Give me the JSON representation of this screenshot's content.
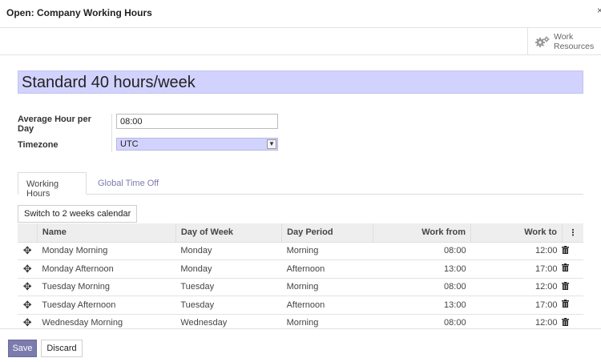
{
  "modal": {
    "title": "Open: Company Working Hours",
    "close": "×"
  },
  "button_box": {
    "work_resources_label": "Work Resources",
    "icon": "gears-icon"
  },
  "record": {
    "name": "Standard 40 hours/week"
  },
  "fields": {
    "avg_hour_label": "Average Hour per Day",
    "avg_hour_value": "08:00",
    "timezone_label": "Timezone",
    "timezone_value": "UTC"
  },
  "tabs": [
    {
      "label": "Working Hours",
      "active": true
    },
    {
      "label": "Global Time Off",
      "active": false
    }
  ],
  "switch_button": "Switch to 2 weeks calendar",
  "table": {
    "headers": {
      "name": "Name",
      "day_of_week": "Day of Week",
      "day_period": "Day Period",
      "work_from": "Work from",
      "work_to": "Work to",
      "options": "⋮"
    },
    "rows": [
      {
        "name": "Monday Morning",
        "day_of_week": "Monday",
        "day_period": "Morning",
        "work_from": "08:00",
        "work_to": "12:00"
      },
      {
        "name": "Monday Afternoon",
        "day_of_week": "Monday",
        "day_period": "Afternoon",
        "work_from": "13:00",
        "work_to": "17:00"
      },
      {
        "name": "Tuesday Morning",
        "day_of_week": "Tuesday",
        "day_period": "Morning",
        "work_from": "08:00",
        "work_to": "12:00"
      },
      {
        "name": "Tuesday Afternoon",
        "day_of_week": "Tuesday",
        "day_period": "Afternoon",
        "work_from": "13:00",
        "work_to": "17:00"
      },
      {
        "name": "Wednesday Morning",
        "day_of_week": "Wednesday",
        "day_period": "Morning",
        "work_from": "08:00",
        "work_to": "12:00"
      }
    ]
  },
  "footer": {
    "save_label": "Save",
    "discard_label": "Discard"
  },
  "colors": {
    "accent": "#7c7bad",
    "required_field_bg": "#d2d2ff"
  }
}
